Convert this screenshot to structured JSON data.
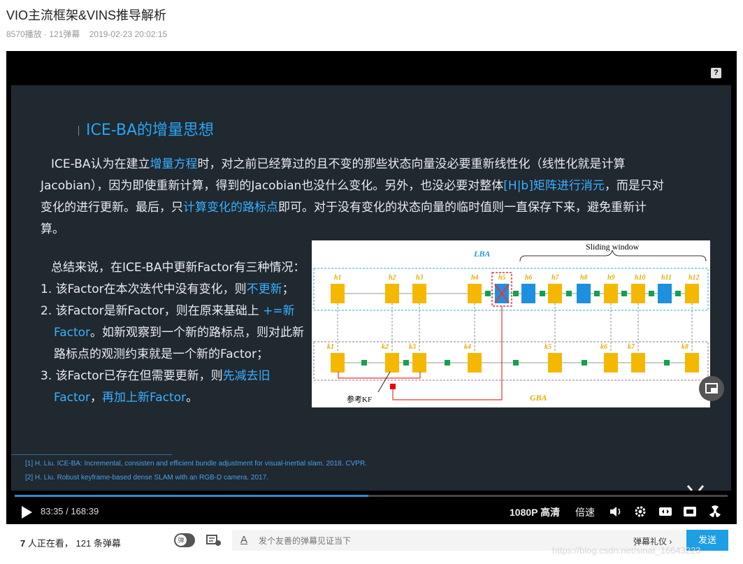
{
  "page": {
    "title": "VIO主流框架&VINS推导解析",
    "plays": "8570播放 · 121弹幕",
    "date": "2019-02-23 20:02:15"
  },
  "slide": {
    "heading": "ICE-BA的增量思想",
    "para": [
      {
        "t": "ICE-BA认为在建立",
        "h": false
      },
      {
        "t": "增量方程",
        "h": true
      },
      {
        "t": "时，对之前已经算过的且不变的那些状态向量没必要重新线性化（线性化就是计算Jacobian），因为即使重新计算，得到的Jacobian也没什么变化。另外，也没必要对整体",
        "h": false
      },
      {
        "t": "[H|b]矩阵进行消元",
        "h": true
      },
      {
        "t": "，而是只对变化的进行更新。最后，只",
        "h": false
      },
      {
        "t": "计算变化的路标点",
        "h": true
      },
      {
        "t": "即可。对于没有变化的状态向量的临时值则一直保存下来，避免重新计算。",
        "h": false
      }
    ],
    "summary_intro": "总结来说，在ICE-BA中更新Factor有三种情况：",
    "item1": [
      {
        "t": "1. 该Factor在本次迭代中没有变化，则",
        "h": false
      },
      {
        "t": "不更新",
        "h": true
      },
      {
        "t": "；",
        "h": false
      }
    ],
    "item2": [
      {
        "t": "2. 该Factor是新Factor，则在原来基础上 ",
        "h": false
      },
      {
        "t": "+=新Factor",
        "h": true
      },
      {
        "t": "。如新观察到一个新的路标点，则对此新路标点的观测约束就是一个新的Factor；",
        "h": false
      }
    ],
    "item3": [
      {
        "t": "3. 该Factor已存在但需要更新，则",
        "h": false
      },
      {
        "t": "先减去旧Factor",
        "h": true
      },
      {
        "t": "，",
        "h": false
      },
      {
        "t": "再加上新Factor",
        "h": true
      },
      {
        "t": "。",
        "h": false
      }
    ],
    "ref1": "[1] H. Liu. ICE-BA: Incremental, consisten and efficient bundle adjustment for visual-inertial slam. 2018. CVPR.",
    "ref2": "[2] H. Liu. Robust keyframe-based dense SLAM with an RGB-D camera. 2017."
  },
  "figure": {
    "lba": "LBA",
    "gba": "GBA",
    "sliding_window": "Sliding window",
    "ref_kf": "参考KF",
    "h_labels": [
      "h1",
      "h2",
      "h3",
      "h4",
      "h5",
      "h6",
      "h7",
      "h8",
      "h9",
      "h10",
      "h11",
      "h12"
    ],
    "k_labels": [
      "k1",
      "k2",
      "k3",
      "k4",
      "k5",
      "k6",
      "k7",
      "k8"
    ]
  },
  "player": {
    "current_time": "83:35",
    "separator": "/",
    "total_time": "168:39",
    "progress": 0.496,
    "quality": "1080P 高清",
    "speed": "倍速"
  },
  "bottom": {
    "viewers_count": "7",
    "viewers_text": "人正在看，",
    "danmaku_count": "121",
    "danmaku_text": "条弹幕",
    "toggle_label": "弹",
    "input_placeholder": "发个友善的弹幕见证当下",
    "gift": "弹幕礼仪 ›",
    "send": "发送"
  },
  "watermark": "https://blog.csdn.net/sinat_16643223",
  "colors": {
    "accent": "#2aa5f0",
    "slide_bg": "#202830",
    "send_btn": "#1e9ee5"
  }
}
